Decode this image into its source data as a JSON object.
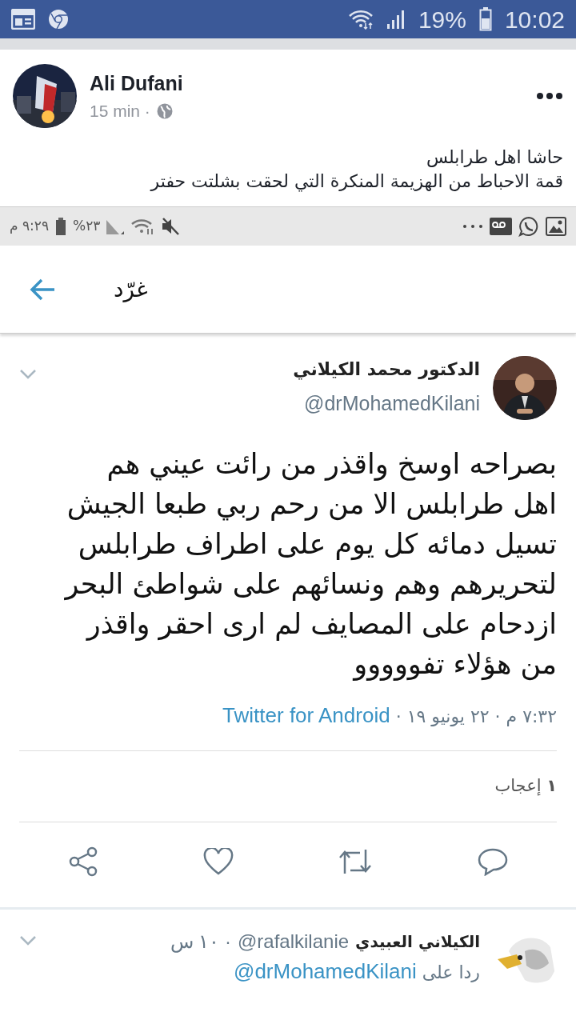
{
  "status_bar": {
    "battery": "19%",
    "time": "10:02"
  },
  "post": {
    "author": "Ali Dufani",
    "time": "15 min ·",
    "text": "حاشا اهل طرابلس\nقمة الاحباط من الهزيمة المنكرة التي لحقت بشلتت حفتر"
  },
  "screenshot": {
    "status_bar": {
      "time": "٩:٢٩ م",
      "battery": "٢٣%"
    },
    "header": {
      "title": "غرّد"
    },
    "tweet": {
      "name": "الدكتور محمد الكيلاني",
      "handle": "@drMohamedKilani",
      "text": "بصراحه اوسخ واقذر من رائت عيني هم\nاهل طرابلس الا من رحم ربي طبعا الجيش\nتسيل دمائه كل يوم على اطراف طرابلس\nلتحريرهم وهم ونسائهم على شواطئ البحر\nازدحام على المصايف لم ارى احقر واقذر\nمن هؤلاء  تفووووو",
      "timestamp": "٧:٣٢ م · ٢٢ يونيو ١٩ · ",
      "source": "Twitter for Android",
      "likes": "**١** إعجاب"
    },
    "reply": {
      "name": "الكيلاني العبيدي",
      "handle": "@rafalkilanie",
      "time": "· ١٠ س",
      "text": "ردا على ",
      "mention": "@drMohamedKilani"
    }
  }
}
